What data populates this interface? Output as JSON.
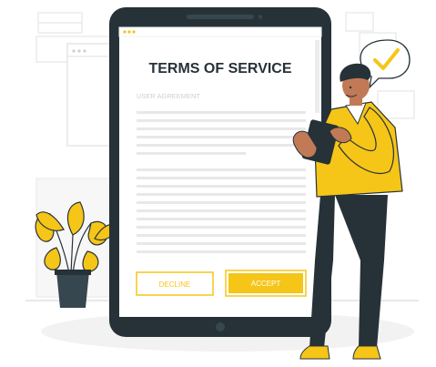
{
  "document": {
    "title": "TERMS OF SERVICE",
    "subtitle": "USER AGREEMENT"
  },
  "buttons": {
    "decline": "DECLINE",
    "accept": "ACCEPT"
  },
  "colors": {
    "accent": "#f5c518",
    "dark": "#263238",
    "muted": "#e6e6e6"
  },
  "icons": [
    "checkmark-speech-bubble-icon",
    "window-dots-icon",
    "home-button-icon",
    "camera-icon",
    "potted-plant-icon"
  ]
}
